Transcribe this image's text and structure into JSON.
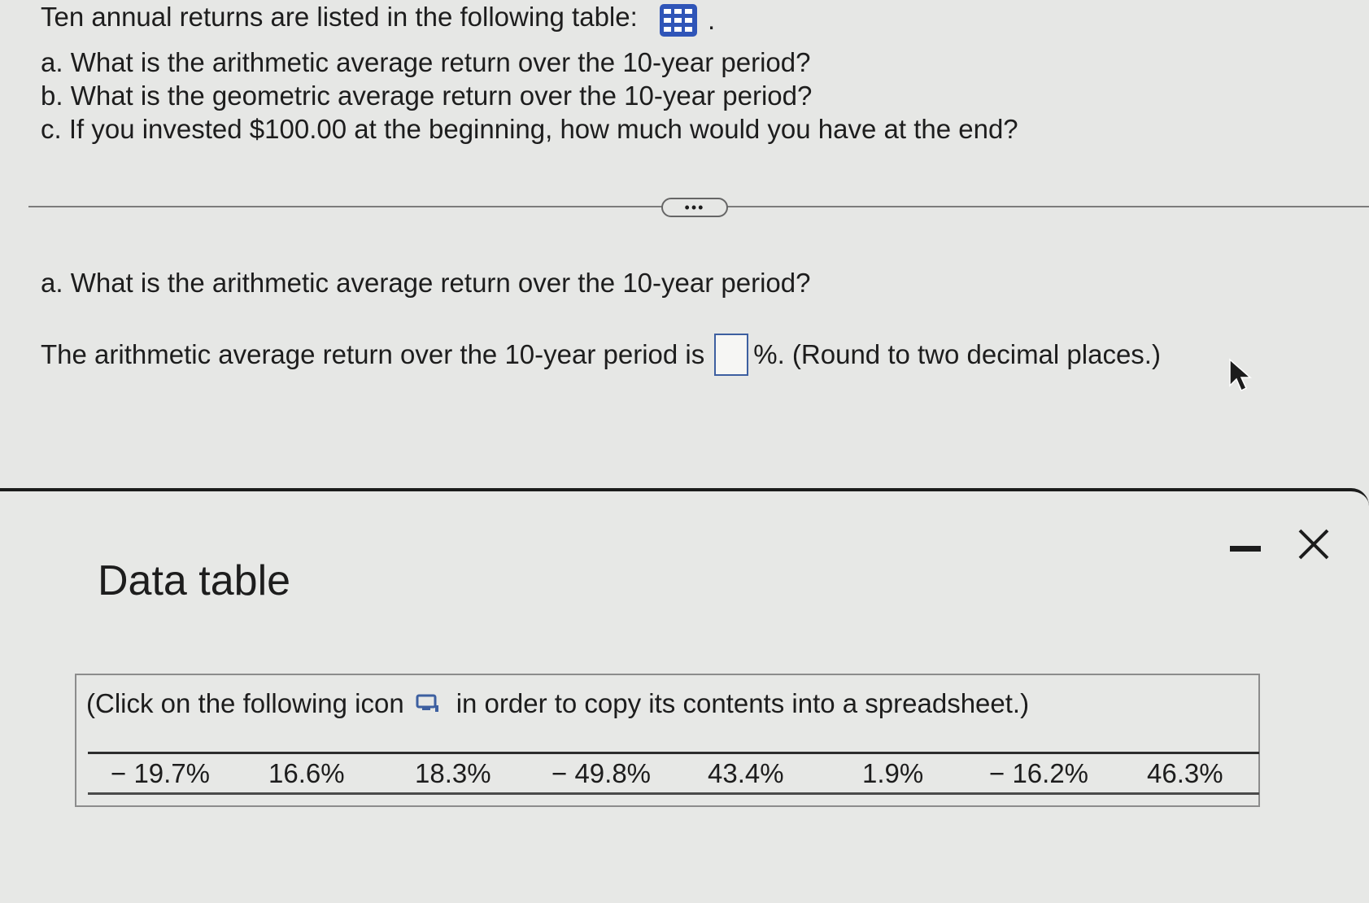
{
  "question": {
    "intro": "Ten annual returns are listed in the following table:",
    "intro_end": ".",
    "table_icon": "grid-icon",
    "parts": {
      "a": "a. What is the arithmetic average return over the 10-year period?",
      "b": "b. What is the geometric average return over the 10-year period?",
      "c": "c. If you invested $100.00 at the beginning, how much would you have at the end?"
    }
  },
  "more_button": "•••",
  "answer": {
    "heading": "a. What is the arithmetic average return over the 10-year period?",
    "prefix": "The arithmetic average return over the 10-year period is",
    "input_value": "",
    "suffix": "%. (Round to two decimal places.)"
  },
  "dialog": {
    "title": "Data table",
    "instructions_before": "(Click on the following icon",
    "instructions_after": "in order to copy its contents into a spreadsheet.)",
    "returns": [
      "− 19.7%",
      "16.6%",
      "18.3%",
      "− 49.8%",
      "43.4%",
      "1.9%",
      "− 16.2%",
      "46.3%"
    ]
  },
  "colors": {
    "accent": "#3d5fa0",
    "background": "#e6e7e5",
    "text": "#1d1d1d"
  }
}
